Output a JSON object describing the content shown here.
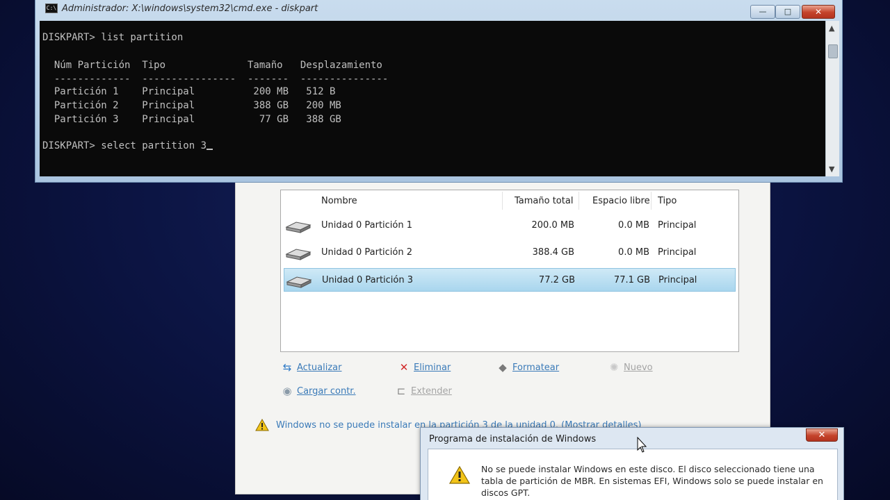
{
  "cmd": {
    "icon_text": "C:\\",
    "title": "Administrador: X:\\windows\\system32\\cmd.exe - diskpart",
    "buttons": {
      "minimize": "—",
      "maximize": "□",
      "close": "✕"
    },
    "console": {
      "prompt1": "DISKPART> list partition",
      "header": "  Núm Partición  Tipo              Tamaño   Desplazamiento",
      "separator": "  -------------  ----------------  -------  ---------------",
      "rows": [
        "  Partición 1    Principal          200 MB   512 B",
        "  Partición 2    Principal          388 GB   200 MB",
        "  Partición 3    Principal           77 GB   388 GB"
      ],
      "prompt2": "DISKPART> select partition 3"
    }
  },
  "setup": {
    "columns": {
      "name": "Nombre",
      "total": "Tamaño total",
      "free": "Espacio libre",
      "type": "Tipo"
    },
    "rows": [
      {
        "name": "Unidad 0 Partición 1",
        "total": "200.0 MB",
        "free": "0.0 MB",
        "type": "Principal"
      },
      {
        "name": "Unidad 0 Partición 2",
        "total": "388.4 GB",
        "free": "0.0 MB",
        "type": "Principal"
      },
      {
        "name": "Unidad 0 Partición 3",
        "total": "77.2 GB",
        "free": "77.1 GB",
        "type": "Principal"
      }
    ],
    "actions": {
      "refresh": "Actualizar",
      "delete": "Eliminar",
      "format": "Formatear",
      "new": "Nuevo",
      "load_driver": "Cargar contr.",
      "extend": "Extender"
    },
    "warning": "Windows no se puede instalar en la partición 3 de la unidad 0. (Mostrar detalles)"
  },
  "dialog": {
    "title": "Programa de instalación de Windows",
    "close": "✕",
    "message": "No se puede instalar Windows en este disco. El disco seleccionado tiene una tabla de partición de MBR. En sistemas EFI, Windows solo se puede instalar en discos GPT."
  }
}
